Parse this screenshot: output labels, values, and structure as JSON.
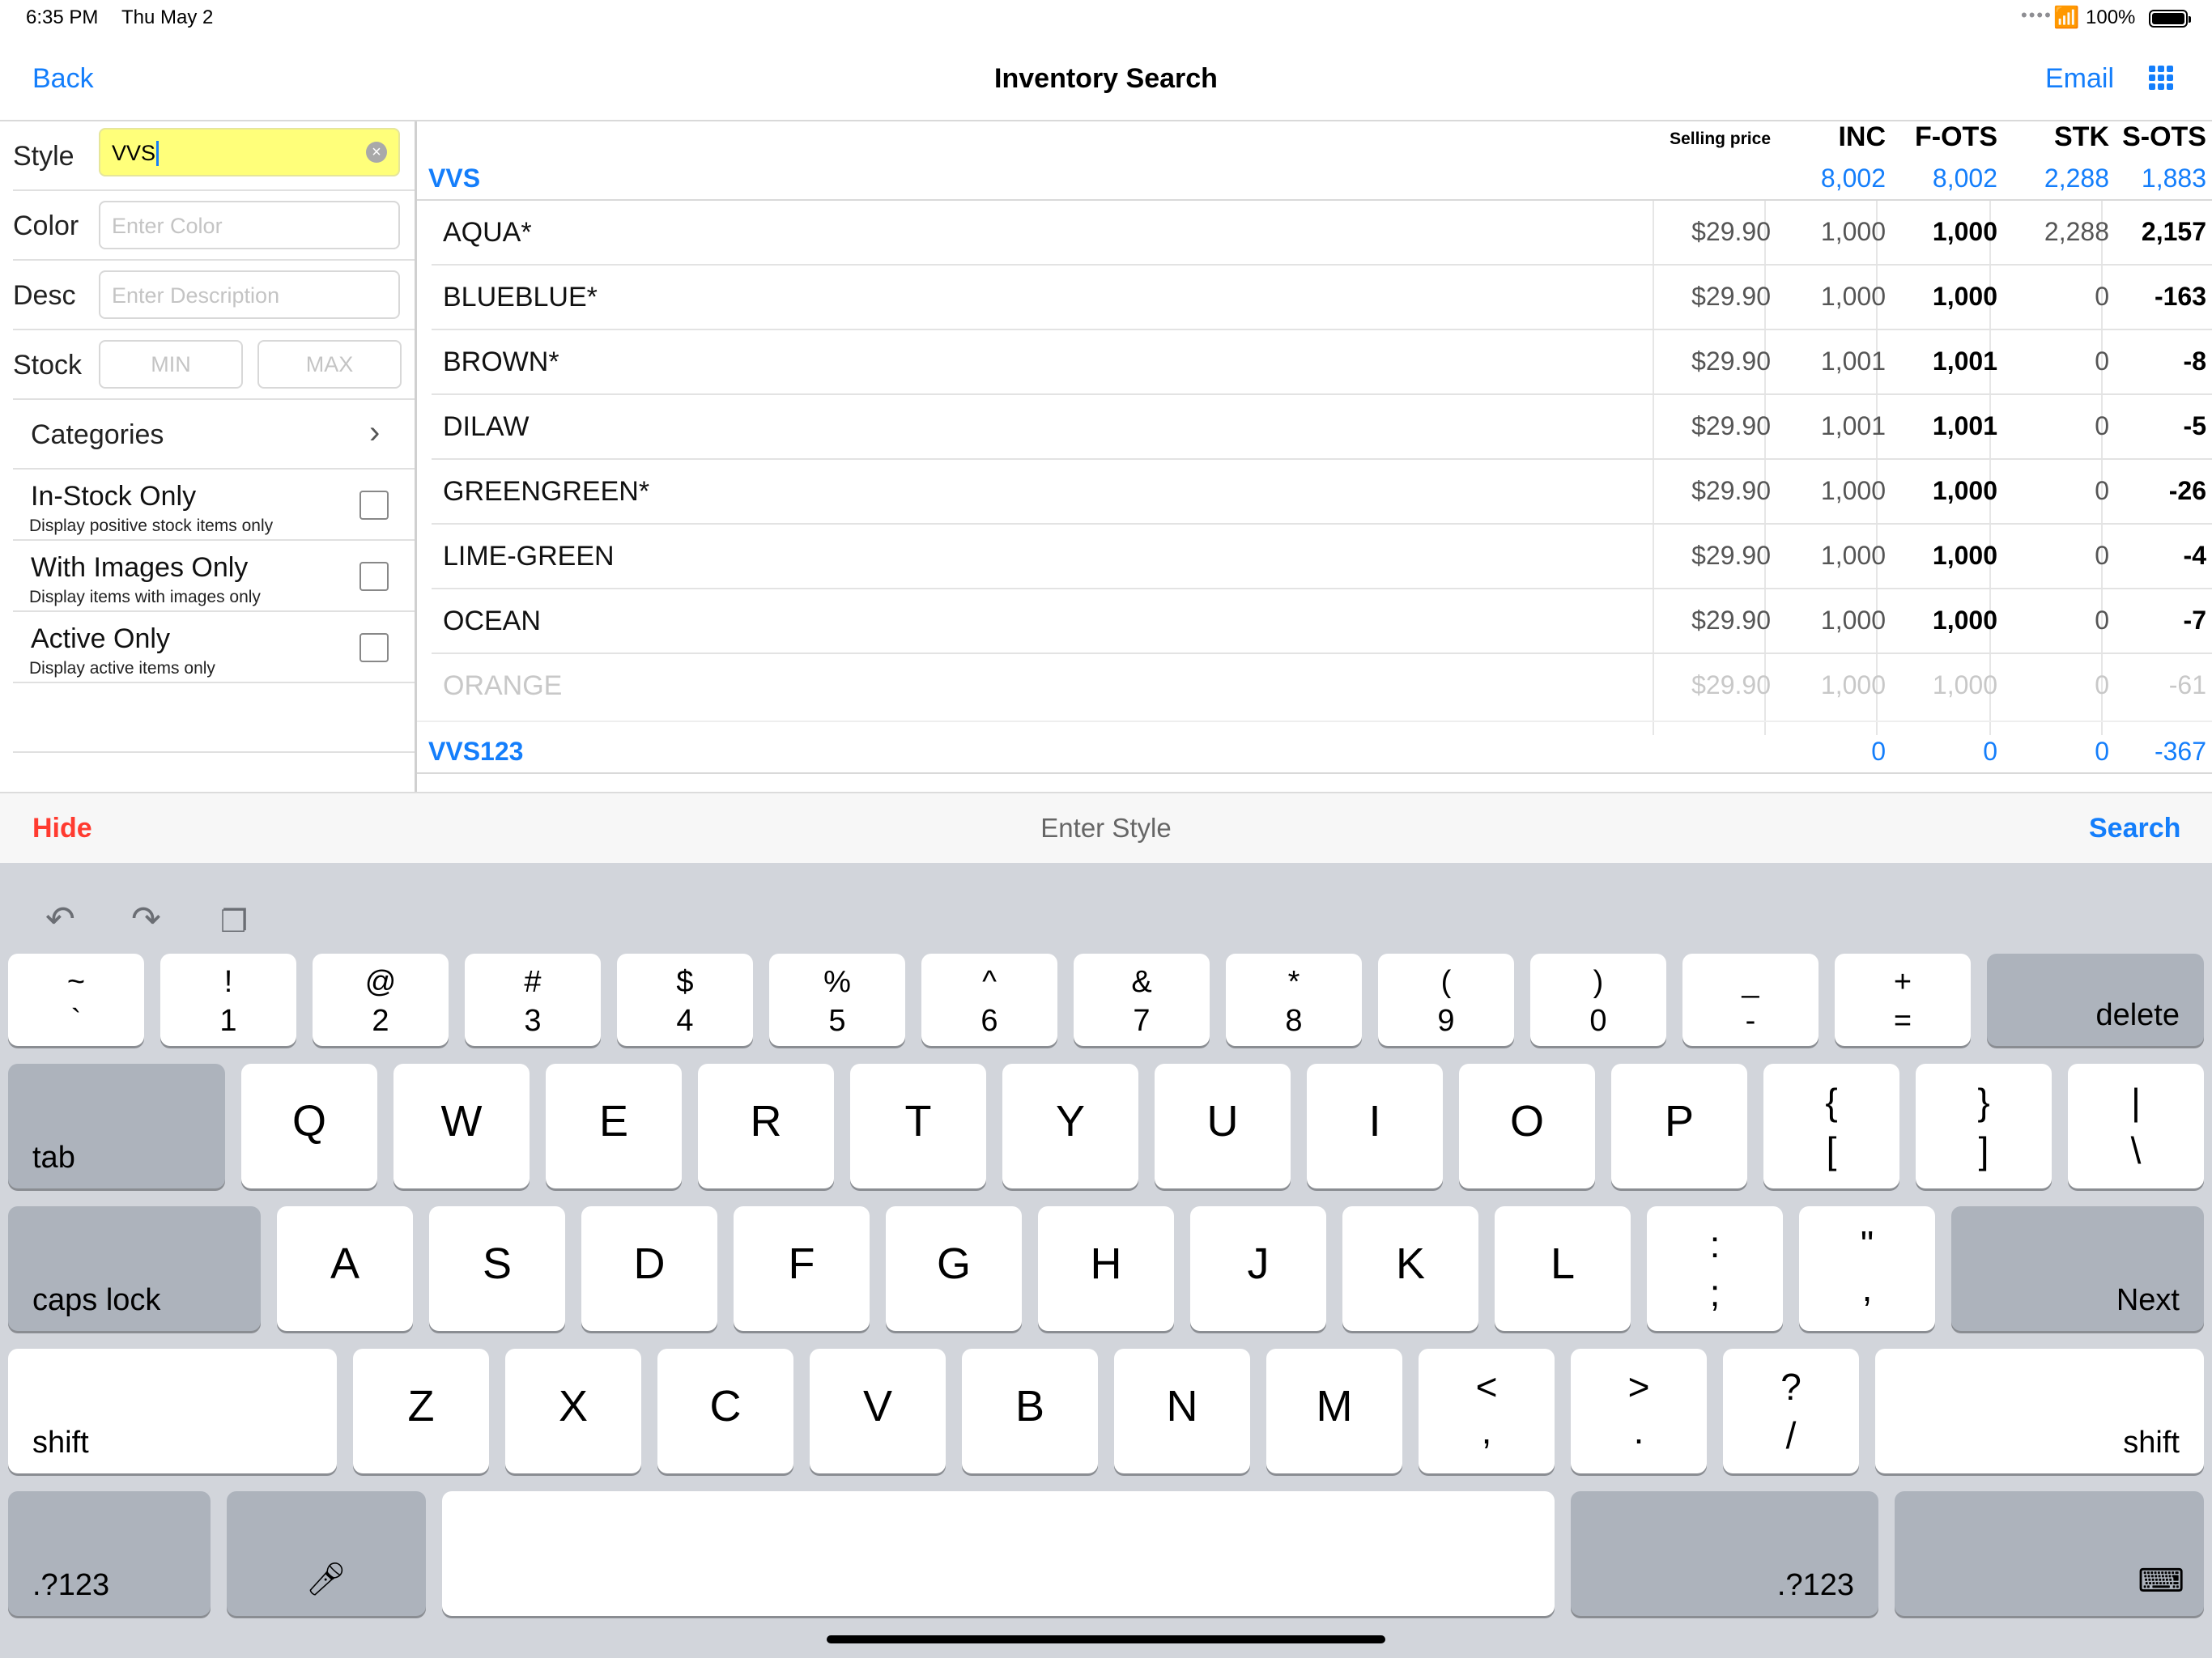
{
  "status": {
    "time": "6:35 PM",
    "date": "Thu May 2",
    "battery_pct": "100%"
  },
  "nav": {
    "back": "Back",
    "title": "Inventory Search",
    "email": "Email"
  },
  "filters": {
    "style": {
      "label": "Style",
      "value": "VVS"
    },
    "color": {
      "label": "Color",
      "placeholder": "Enter Color"
    },
    "desc": {
      "label": "Desc",
      "placeholder": "Enter Description"
    },
    "stock": {
      "label": "Stock",
      "min_placeholder": "MIN",
      "max_placeholder": "MAX"
    },
    "categories": "Categories",
    "in_stock": {
      "title": "In-Stock Only",
      "subtitle": "Display positive stock items only",
      "checked": false
    },
    "with_images": {
      "title": "With Images Only",
      "subtitle": "Display items with images only",
      "checked": false
    },
    "active_only": {
      "title": "Active Only",
      "subtitle": "Display active items only",
      "checked": false
    }
  },
  "table": {
    "headers": {
      "selling_price": "Selling price",
      "inc": "INC",
      "f_ots": "F-OTS",
      "stk": "STK",
      "s_ots": "S-OTS"
    },
    "groups": [
      {
        "name": "VVS",
        "totals": {
          "inc": "8,002",
          "f_ots": "8,002",
          "stk": "2,288",
          "s_ots": "1,883"
        },
        "rows": [
          {
            "name": "AQUA*",
            "price": "$29.90",
            "inc": "1,000",
            "f_ots": "1,000",
            "stk": "2,288",
            "s_ots": "2,157"
          },
          {
            "name": "BLUEBLUE*",
            "price": "$29.90",
            "inc": "1,000",
            "f_ots": "1,000",
            "stk": "0",
            "s_ots": "-163"
          },
          {
            "name": "BROWN*",
            "price": "$29.90",
            "inc": "1,001",
            "f_ots": "1,001",
            "stk": "0",
            "s_ots": "-8"
          },
          {
            "name": "DILAW",
            "price": "$29.90",
            "inc": "1,001",
            "f_ots": "1,001",
            "stk": "0",
            "s_ots": "-5"
          },
          {
            "name": "GREENGREEN*",
            "price": "$29.90",
            "inc": "1,000",
            "f_ots": "1,000",
            "stk": "0",
            "s_ots": "-26"
          },
          {
            "name": "LIME-GREEN",
            "price": "$29.90",
            "inc": "1,000",
            "f_ots": "1,000",
            "stk": "0",
            "s_ots": "-4"
          },
          {
            "name": "OCEAN",
            "price": "$29.90",
            "inc": "1,000",
            "f_ots": "1,000",
            "stk": "0",
            "s_ots": "-7"
          },
          {
            "name": "ORANGE",
            "price": "$29.90",
            "inc": "1,000",
            "f_ots": "1,000",
            "stk": "0",
            "s_ots": "-61"
          }
        ]
      },
      {
        "name": "VVS123",
        "totals": {
          "inc": "0",
          "f_ots": "0",
          "stk": "0",
          "s_ots": "-367"
        }
      }
    ]
  },
  "accessory": {
    "hide": "Hide",
    "prompt": "Enter Style",
    "search": "Search"
  },
  "keyboard": {
    "row1": [
      {
        "top": "~",
        "bot": "`"
      },
      {
        "top": "!",
        "bot": "1"
      },
      {
        "top": "@",
        "bot": "2"
      },
      {
        "top": "#",
        "bot": "3"
      },
      {
        "top": "$",
        "bot": "4"
      },
      {
        "top": "%",
        "bot": "5"
      },
      {
        "top": "^",
        "bot": "6"
      },
      {
        "top": "&",
        "bot": "7"
      },
      {
        "top": "*",
        "bot": "8"
      },
      {
        "top": "(",
        "bot": "9"
      },
      {
        "top": ")",
        "bot": "0"
      },
      {
        "top": "_",
        "bot": "-"
      },
      {
        "top": "+",
        "bot": "="
      }
    ],
    "delete": "delete",
    "tab": "tab",
    "row2": [
      "Q",
      "W",
      "E",
      "R",
      "T",
      "Y",
      "U",
      "I",
      "O",
      "P"
    ],
    "row2_sym": [
      {
        "top": "{",
        "bot": "["
      },
      {
        "top": "}",
        "bot": "]"
      },
      {
        "top": "|",
        "bot": "\\"
      }
    ],
    "caps_lock": "caps lock",
    "row3": [
      "A",
      "S",
      "D",
      "F",
      "G",
      "H",
      "J",
      "K",
      "L"
    ],
    "row3_sym": [
      {
        "top": ":",
        "bot": ";"
      },
      {
        "top": "\"",
        "bot": ","
      }
    ],
    "next": "Next",
    "shift": "shift",
    "row4": [
      "Z",
      "X",
      "C",
      "V",
      "B",
      "N",
      "M"
    ],
    "row4_sym": [
      {
        "top": "<",
        "bot": ","
      },
      {
        "top": ">",
        "bot": "."
      },
      {
        "top": "?",
        "bot": "/"
      }
    ],
    "num_left": ".?123",
    "num_right": ".?123"
  }
}
